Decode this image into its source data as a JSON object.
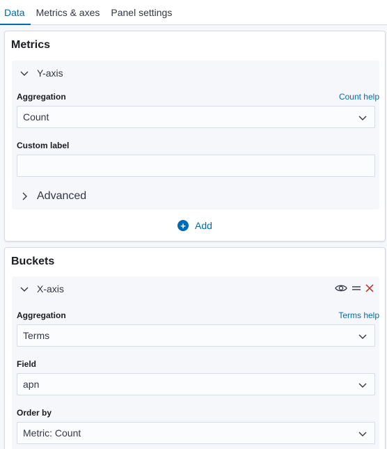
{
  "tabs": [
    {
      "label": "Data",
      "active": true
    },
    {
      "label": "Metrics & axes",
      "active": false
    },
    {
      "label": "Panel settings",
      "active": false
    }
  ],
  "metrics": {
    "title": "Metrics",
    "yaxis": {
      "title": "Y-axis",
      "aggregation_label": "Aggregation",
      "help_link": "Count help",
      "aggregation_value": "Count",
      "custom_label_label": "Custom label",
      "custom_label_value": "",
      "advanced_label": "Advanced"
    },
    "add_label": "Add"
  },
  "buckets": {
    "title": "Buckets",
    "xaxis": {
      "title": "X-axis",
      "aggregation_label": "Aggregation",
      "help_link": "Terms help",
      "aggregation_value": "Terms",
      "field_label": "Field",
      "field_value": "apn",
      "order_by_label": "Order by",
      "order_by_value": "Metric: Count"
    }
  },
  "icons": {
    "chevron_down": "chevron-down-icon",
    "chevron_right": "chevron-right-icon",
    "eye": "eye-icon",
    "drag": "drag-handle-icon",
    "remove": "close-icon",
    "plus": "plus-circle-icon"
  },
  "colors": {
    "accent": "#006bb4",
    "danger": "#bd271e"
  }
}
